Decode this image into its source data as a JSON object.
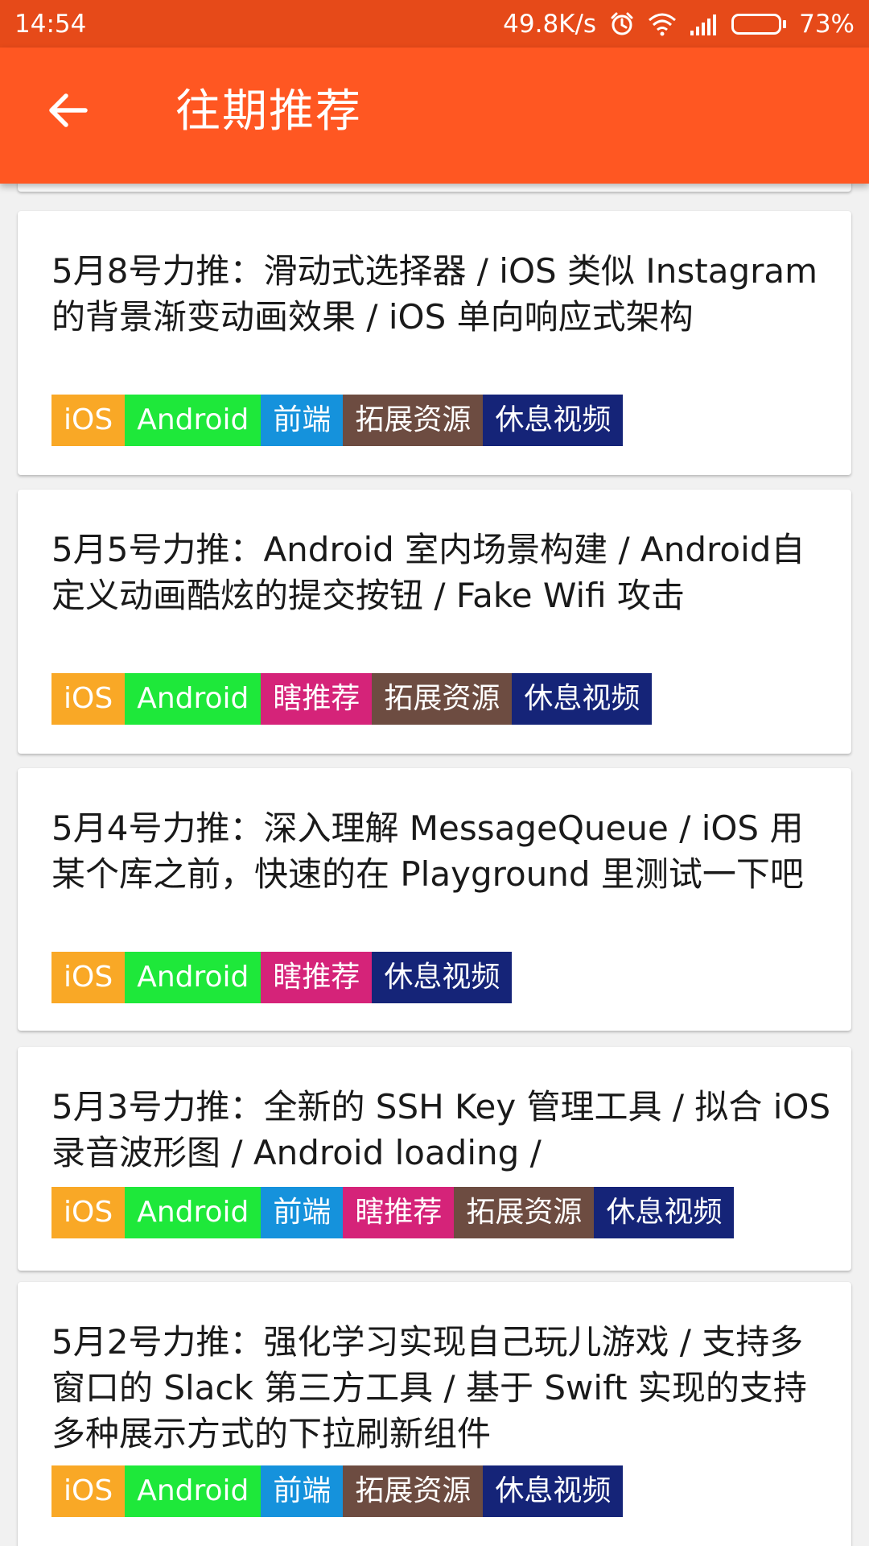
{
  "status_bar": {
    "time": "14:54",
    "speed": "49.8K/s",
    "battery": "73%",
    "battery_level": 0.73,
    "icons": [
      "alarm-icon",
      "wifi-icon",
      "signal-icon",
      "battery-icon"
    ]
  },
  "app_bar": {
    "title": "往期推荐",
    "back_icon": "arrow-back-icon",
    "background": "#ff5722",
    "status_background": "#e64a19"
  },
  "tag_colors": {
    "iOS": "#f9a826",
    "Android": "#1ee83a",
    "前端": "#1592dc",
    "瞎推荐": "#d52379",
    "拓展资源": "#6d4c41",
    "休息视频": "#152478"
  },
  "cards": [
    {
      "title": "5月8号力推：滑动式选择器 / iOS 类似 Instagram 的背景渐变动画效果 / iOS 单向响应式架构",
      "tags": [
        "iOS",
        "Android",
        "前端",
        "拓展资源",
        "休息视频"
      ]
    },
    {
      "title": "5月5号力推：Android 室内场景构建 / Android自定义动画酷炫的提交按钮 / Fake Wifi 攻击",
      "tags": [
        "iOS",
        "Android",
        "瞎推荐",
        "拓展资源",
        "休息视频"
      ]
    },
    {
      "title": "5月4号力推：深入理解 MessageQueue / iOS 用某个库之前，快速的在 Playground 里测试一下吧",
      "tags": [
        "iOS",
        "Android",
        "瞎推荐",
        "休息视频"
      ]
    },
    {
      "title": "5月3号力推：全新的 SSH Key 管理工具 / 拟合 iOS 录音波形图 / Android loading /",
      "tags": [
        "iOS",
        "Android",
        "前端",
        "瞎推荐",
        "拓展资源",
        "休息视频"
      ]
    },
    {
      "title": "5月2号力推：强化学习实现自己玩儿游戏 / 支持多窗口的 Slack 第三方工具 / 基于 Swift 实现的支持多种展示方式的下拉刷新组件",
      "tags": [
        "iOS",
        "Android",
        "前端",
        "拓展资源",
        "休息视频"
      ]
    }
  ]
}
